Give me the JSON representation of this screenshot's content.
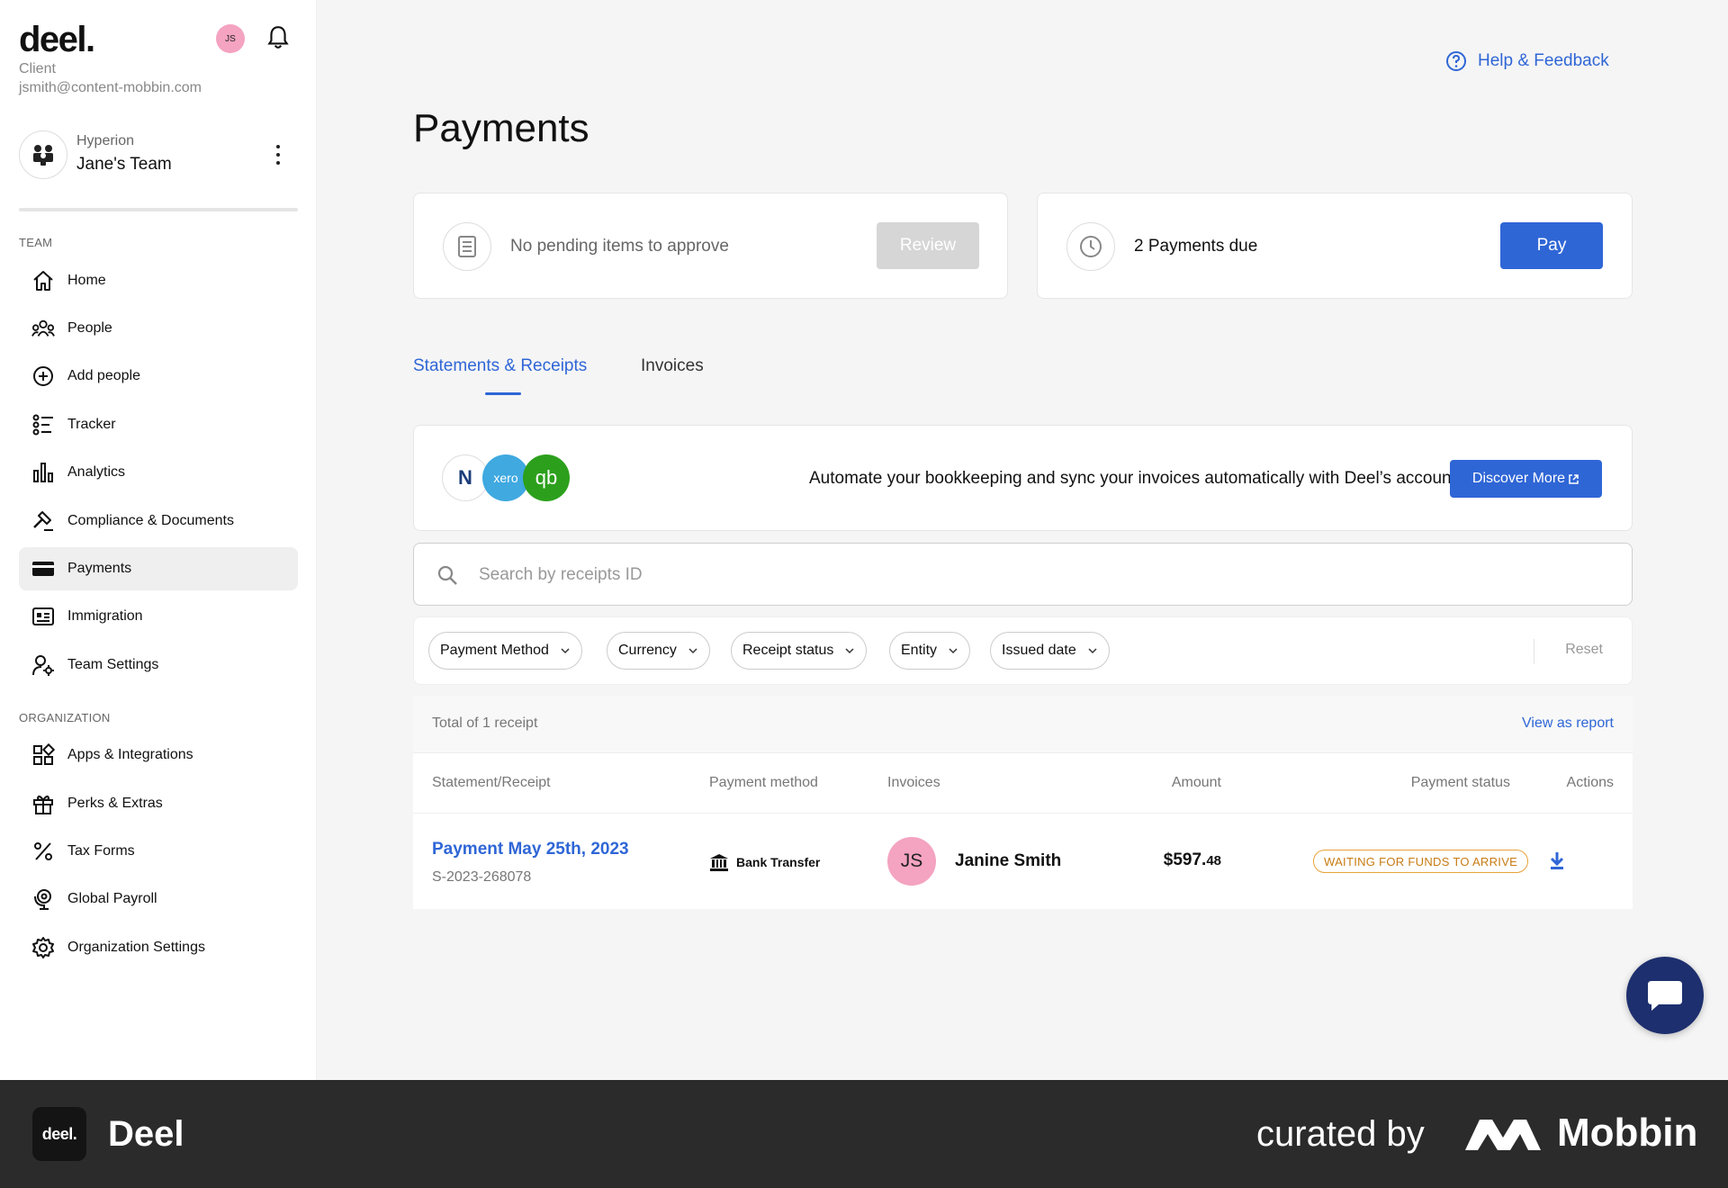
{
  "sidebar": {
    "logo": "deel.",
    "avatar_initials": "JS",
    "role": "Client",
    "email": "jsmith@content-mobbin.com",
    "team": {
      "org": "Hyperion",
      "name": "Jane's Team"
    },
    "team_section_label": "TEAM",
    "team_items": [
      {
        "label": "Home",
        "icon": "home-icon"
      },
      {
        "label": "People",
        "icon": "people-icon"
      },
      {
        "label": "Add people",
        "icon": "add-circle-icon"
      },
      {
        "label": "Tracker",
        "icon": "tracker-list-icon"
      },
      {
        "label": "Analytics",
        "icon": "bar-chart-icon"
      },
      {
        "label": "Compliance & Documents",
        "icon": "gavel-icon"
      },
      {
        "label": "Payments",
        "icon": "credit-card-icon",
        "active": true
      },
      {
        "label": "Immigration",
        "icon": "id-card-icon"
      },
      {
        "label": "Team Settings",
        "icon": "user-gear-icon"
      }
    ],
    "org_section_label": "ORGANIZATION",
    "org_items": [
      {
        "label": "Apps & Integrations",
        "icon": "apps-grid-icon"
      },
      {
        "label": "Perks & Extras",
        "icon": "gift-icon"
      },
      {
        "label": "Tax Forms",
        "icon": "percent-icon"
      },
      {
        "label": "Global Payroll",
        "icon": "globe-pin-icon"
      },
      {
        "label": "Organization Settings",
        "icon": "gear-icon"
      }
    ]
  },
  "header": {
    "help_label": "Help & Feedback",
    "page_title": "Payments"
  },
  "summary": {
    "pending_text": "No pending items to approve",
    "review_label": "Review",
    "due_text": "2 Payments due",
    "pay_label": "Pay"
  },
  "tabs": [
    {
      "label": "Statements & Receipts",
      "active": true
    },
    {
      "label": "Invoices",
      "active": false
    }
  ],
  "promo": {
    "logos": [
      "N",
      "xero",
      "qb"
    ],
    "text": "Automate your bookkeeping and sync your invoices automatically with Deel’s accounting integrations.",
    "button_label": "Discover More"
  },
  "search": {
    "placeholder": "Search by receipts ID",
    "value": ""
  },
  "filters": {
    "items": [
      "Payment Method",
      "Currency",
      "Receipt status",
      "Entity",
      "Issued date"
    ],
    "reset_label": "Reset"
  },
  "table": {
    "total_text": "Total of 1 receipt",
    "view_report_label": "View as report",
    "columns": [
      "Statement/Receipt",
      "Payment method",
      "Invoices",
      "Amount",
      "Payment status",
      "Actions"
    ],
    "rows": [
      {
        "statement": "Payment May 25th, 2023",
        "statement_id": "S-2023-268078",
        "payment_method": "Bank Transfer",
        "invoice_initials": "JS",
        "invoice_name": "Janine Smith",
        "amount_main": "$597.",
        "amount_cents": "48",
        "status": "WAITING FOR FUNDS TO ARRIVE"
      }
    ]
  },
  "footer": {
    "logo_text": "deel.",
    "app_name": "Deel",
    "curated_by": "curated by",
    "brand": "Mobbin"
  },
  "colors": {
    "accent": "#2f66d6",
    "status_warning": "#e8a33a",
    "chat_button": "#1d2f6e",
    "avatar_pink": "#f4a3c0"
  }
}
